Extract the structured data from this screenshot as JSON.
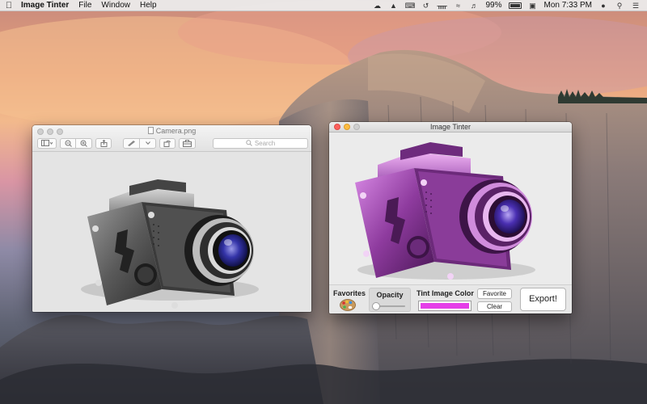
{
  "menubar": {
    "app_name": "Image Tinter",
    "items": [
      "File",
      "Window",
      "Help"
    ],
    "battery_percent": "99%",
    "clock": "Mon 7:33 PM"
  },
  "preview_window": {
    "title": "Camera.png",
    "search_placeholder": "Search"
  },
  "tinter_window": {
    "title": "Image Tinter",
    "favorites_label": "Favorites",
    "opacity_label": "Opacity",
    "opacity_value": 0.06,
    "tint_label": "Tint Image Color",
    "favorite_button": "Favorite",
    "clear_button": "Clear",
    "export_button": "Export!",
    "tint_color": "#e53ee8"
  },
  "icons": {
    "menubar": [
      "apple-logo",
      "bluetooth-icon",
      "wifi-icon",
      "volume-icon",
      "battery-icon",
      "user-icon",
      "spotlight-icon",
      "notification-center-icon"
    ],
    "preview_toolbar": [
      "sidebar-icon",
      "zoom-out-icon",
      "zoom-in-icon",
      "share-icon",
      "markup-pen-icon",
      "rotate-icon",
      "toolbox-icon"
    ]
  }
}
